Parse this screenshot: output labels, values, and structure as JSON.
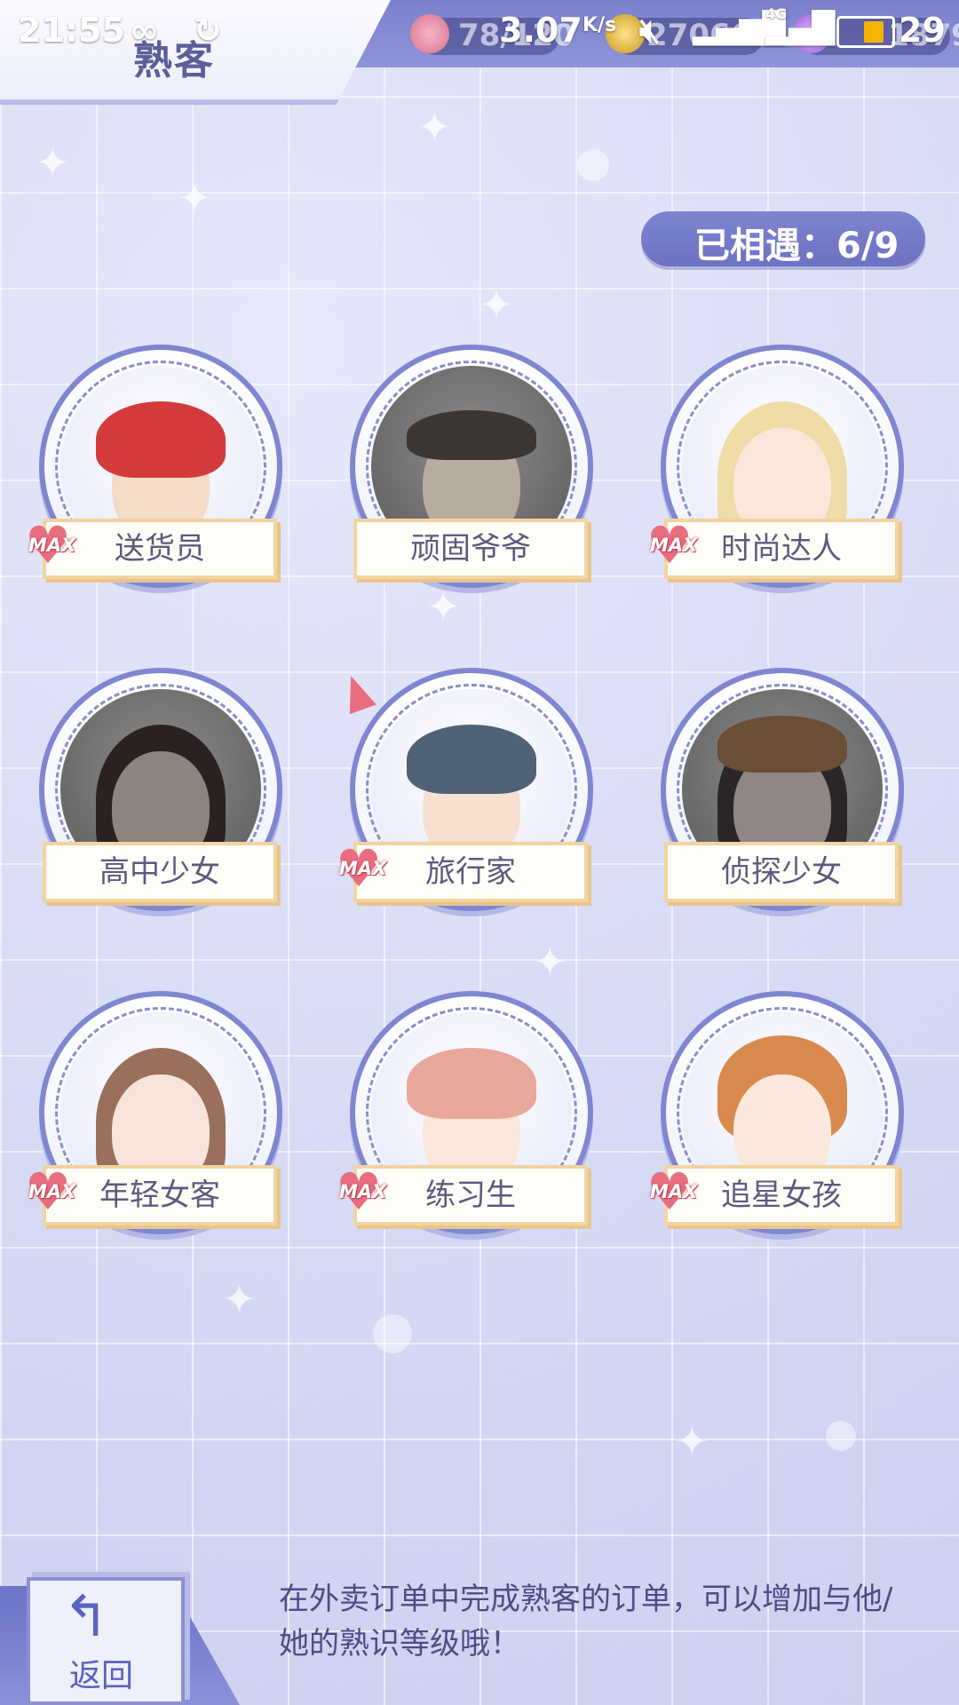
{
  "status_bar": {
    "time": "21:55",
    "net_speed": "3.07",
    "net_unit": "K/s",
    "network_type": "4G",
    "battery": "29"
  },
  "header": {
    "title": "熟客",
    "resources": [
      {
        "icon": "cupcake-icon",
        "value": "78/120"
      },
      {
        "icon": "gold-coin-icon",
        "value": "270662"
      },
      {
        "icon": "gem-icon",
        "value": "1879"
      }
    ]
  },
  "encounter": {
    "label": "已相遇：",
    "count": "6/9"
  },
  "customers": [
    {
      "name": "送货员",
      "max": true
    },
    {
      "name": "顽固爷爷",
      "max": false
    },
    {
      "name": "时尚达人",
      "max": true
    },
    {
      "name": "高中少女",
      "max": false
    },
    {
      "name": "旅行家",
      "max": true
    },
    {
      "name": "侦探少女",
      "max": false
    },
    {
      "name": "年轻女客",
      "max": true
    },
    {
      "name": "练习生",
      "max": true
    },
    {
      "name": "追星女孩",
      "max": true
    }
  ],
  "badge_text": "MAX",
  "footer": {
    "back_label": "返回",
    "hint": "在外卖订单中完成熟客的订单，可以增加与他/她的熟识等级哦！"
  }
}
